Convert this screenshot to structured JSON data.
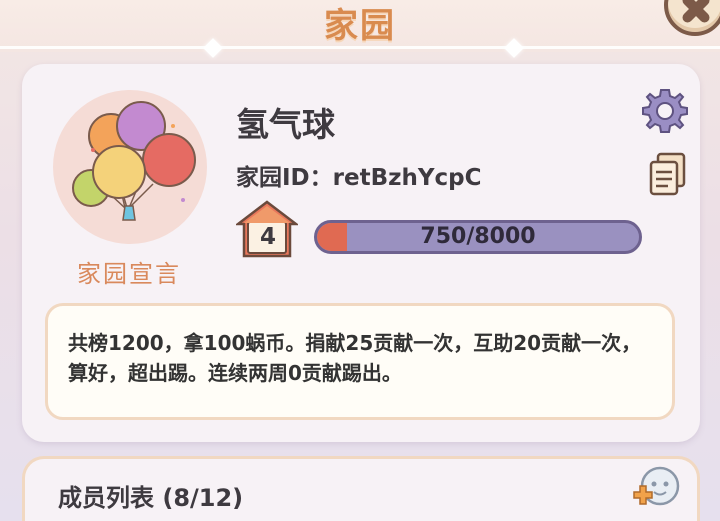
{
  "header": {
    "title": "家园"
  },
  "profile": {
    "name": "氢气球",
    "home_id": "家园ID：retBzhYcpC",
    "avatar_label": "家园宣言",
    "level": "4",
    "progress_text": "750/8000",
    "progress_fraction": 0.094
  },
  "declaration": {
    "text": "共榜1200，拿100蜗币。捐献25贡献一次，互助20贡献一次，算好，超出踢。连续两周0贡献踢出。"
  },
  "members": {
    "title": "成员列表 (8/12)"
  },
  "colors": {
    "title": "#d98b4f",
    "progress_bg": "#9a91c0",
    "progress_fill": "#e06a52",
    "card_bg": "#f7f2f6",
    "border": "#f1d8c1"
  },
  "icons": {
    "close": "close-icon",
    "gear": "gear-icon",
    "copy": "copy-icon",
    "level": "house-badge-icon",
    "add_member": "add-member-icon",
    "avatar": "balloons-avatar"
  }
}
